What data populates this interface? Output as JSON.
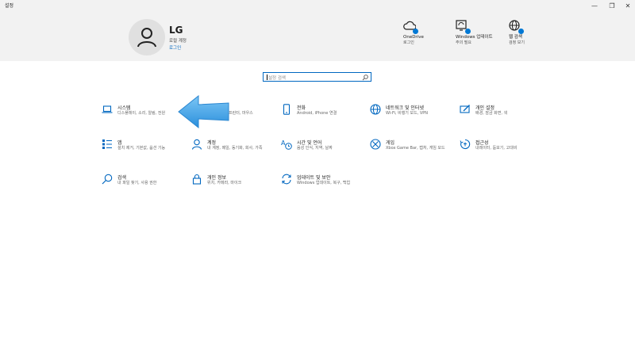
{
  "window": {
    "title": "설정",
    "minimize": "—",
    "maximize": "❐",
    "close": "✕"
  },
  "account": {
    "name": "LG",
    "type": "로컬 계정",
    "login": "로그인"
  },
  "header_items": [
    {
      "label": "OneDrive",
      "sub": "로그인",
      "icon": "cloud-icon"
    },
    {
      "label": "Windows 업데이트",
      "sub": "주의 필요",
      "icon": "update-icon"
    },
    {
      "label": "웹 검색",
      "sub": "검정 보기",
      "icon": "globe-icon"
    }
  ],
  "search": {
    "placeholder": "설정 검색"
  },
  "tiles": [
    {
      "title": "시스템",
      "desc": "디스플레이, 소리, 알림, 전원",
      "icon": "laptop-icon"
    },
    {
      "title": "",
      "desc": "프린터, 마우스",
      "icon": "devices-icon"
    },
    {
      "title": "전화",
      "desc": "Android, iPhone 연결",
      "icon": "phone-icon"
    },
    {
      "title": "네트워크 및 인터넷",
      "desc": "Wi-Fi, 비행기 모드, VPN",
      "icon": "globe-icon"
    },
    {
      "title": "개인 설정",
      "desc": "배경, 잠금 화면, 색",
      "icon": "personalize-icon"
    },
    {
      "title": "앱",
      "desc": "설치 제거, 기본값, 옵션 기능",
      "icon": "apps-icon"
    },
    {
      "title": "계정",
      "desc": "내 계정, 메일, 동기화, 회사, 가족",
      "icon": "person-icon"
    },
    {
      "title": "시간 및 언어",
      "desc": "음성 인식, 지역, 날짜",
      "icon": "time-language-icon"
    },
    {
      "title": "게임",
      "desc": "Xbox Game Bar, 캡처, 게임 모드",
      "icon": "xbox-icon"
    },
    {
      "title": "접근성",
      "desc": "내레이터, 돋보기, 고대비",
      "icon": "accessibility-icon"
    },
    {
      "title": "검색",
      "desc": "내 파일 찾기, 사용 권한",
      "icon": "search-icon"
    },
    {
      "title": "개인 정보",
      "desc": "위치, 카메라, 마이크",
      "icon": "lock-icon"
    },
    {
      "title": "업데이트 및 보안",
      "desc": "Windows 업데이트, 복구, 백업",
      "icon": "sync-icon"
    }
  ],
  "colors": {
    "accent": "#0078d4",
    "header_bg": "#f2f2f2",
    "arrow": "#3aa0e8"
  }
}
